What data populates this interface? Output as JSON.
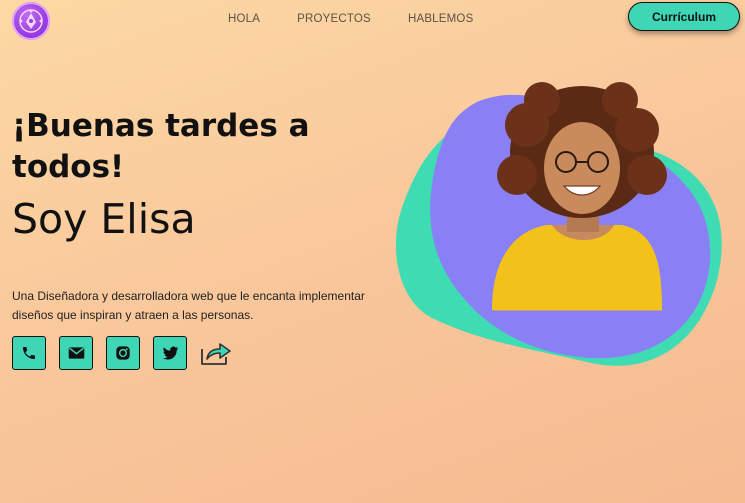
{
  "nav": {
    "items": [
      {
        "label": "HOLA"
      },
      {
        "label": "PROYECTOS"
      },
      {
        "label": "HABLEMOS"
      }
    ]
  },
  "header": {
    "cv_button": "Currículum"
  },
  "hero": {
    "greeting": "¡Buenas tardes a todos!",
    "name": "Soy Elisa",
    "description": "Una Diseñadora y desarrolladora web que le encanta implementar diseños que inspiran y atraen a las personas."
  },
  "socials": [
    {
      "icon": "phone-icon"
    },
    {
      "icon": "mail-icon"
    },
    {
      "icon": "instagram-icon"
    },
    {
      "icon": "twitter-icon"
    },
    {
      "icon": "share-icon"
    }
  ],
  "colors": {
    "accent": "#3ed6b5",
    "blob_purple": "#8a80f5",
    "blob_teal": "#3fdcb4",
    "logo_purple": "#9a3ee0",
    "shirt_yellow": "#f2c21a"
  }
}
